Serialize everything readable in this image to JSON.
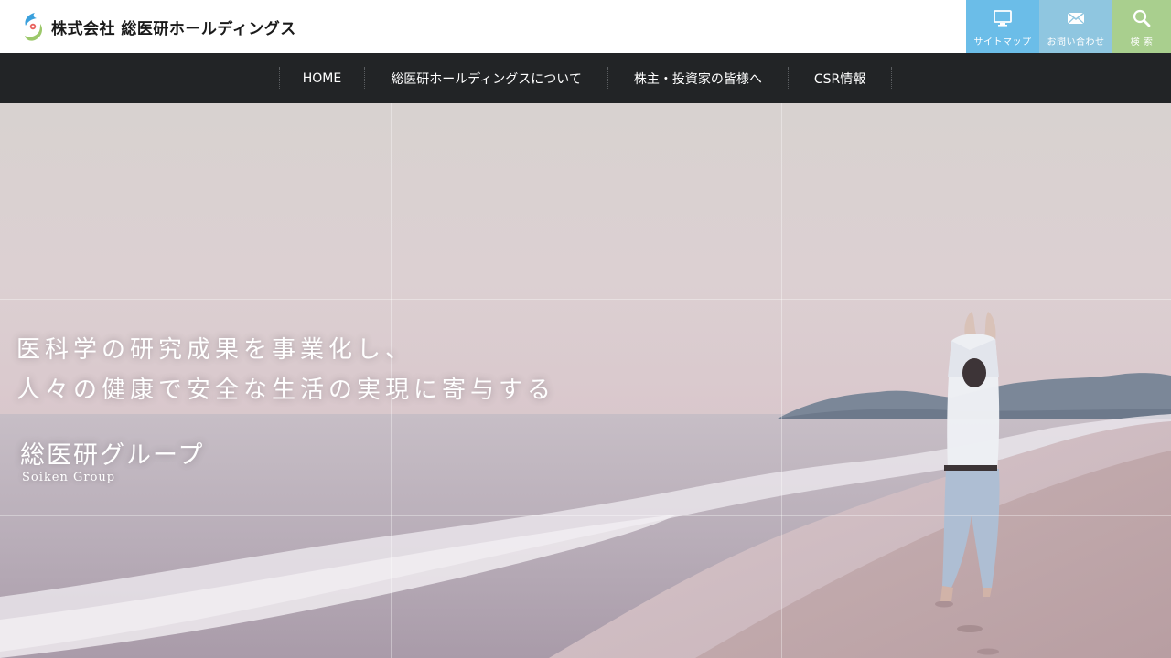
{
  "header": {
    "company_name": "株式会社 総医研ホールディングス",
    "utility": [
      {
        "label": "サイトマップ",
        "icon": "monitor-icon",
        "color": "#6bbde8"
      },
      {
        "label": "お問い合わせ",
        "icon": "mail-icon",
        "color": "#8fc6e0"
      },
      {
        "label": "検 索",
        "icon": "search-icon",
        "color": "#a9cf8e"
      }
    ]
  },
  "nav": {
    "items": [
      {
        "label": "HOME"
      },
      {
        "label": "総医研ホールディングスについて"
      },
      {
        "label": "株主・投資家の皆様へ"
      },
      {
        "label": "CSR情報"
      }
    ]
  },
  "hero": {
    "catch_line1": "医科学の研究成果を事業化し、",
    "catch_line2": "人々の健康で安全な生活の実現に寄与する",
    "group_name": "総医研グループ",
    "group_name_en": "Soiken Group"
  }
}
